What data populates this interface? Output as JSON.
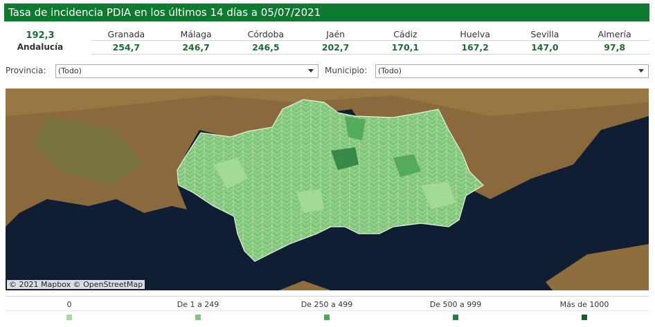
{
  "header": {
    "title": "Tasa de incidencia PDIA en los últimos 14 días a 05/07/2021"
  },
  "summary": {
    "value": "192,3",
    "label": "Andalucía"
  },
  "provinces": [
    {
      "name": "Granada",
      "value": "254,7"
    },
    {
      "name": "Málaga",
      "value": "246,7"
    },
    {
      "name": "Córdoba",
      "value": "246,5"
    },
    {
      "name": "Jaén",
      "value": "202,7"
    },
    {
      "name": "Cádiz",
      "value": "170,1"
    },
    {
      "name": "Huelva",
      "value": "167,2"
    },
    {
      "name": "Sevilla",
      "value": "147,0"
    },
    {
      "name": "Almería",
      "value": "97,8"
    }
  ],
  "filters": {
    "provincia": {
      "label": "Provincia:",
      "value": "(Todo)"
    },
    "municipio": {
      "label": "Municipio:",
      "value": "(Todo)"
    }
  },
  "map": {
    "attribution": "© 2021 Mapbox © OpenStreetMap"
  },
  "legend": [
    {
      "label": "0",
      "color": "#a9dc9b"
    },
    {
      "label": "De 1 a 249",
      "color": "#7fc67a"
    },
    {
      "label": "De 250 a 499",
      "color": "#4fa65a"
    },
    {
      "label": "De 500 a 999",
      "color": "#2a7d3d"
    },
    {
      "label": "Más de 1000",
      "color": "#1a5a2b"
    }
  ]
}
